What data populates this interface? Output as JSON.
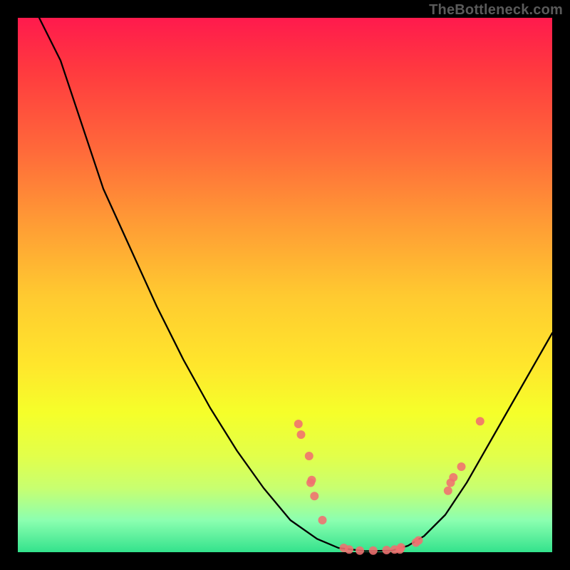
{
  "attribution": "TheBottleneck.com",
  "chart_data": {
    "type": "line",
    "title": "",
    "xlabel": "",
    "ylabel": "",
    "xlim": [
      0,
      100
    ],
    "ylim": [
      0,
      100
    ],
    "series": [
      {
        "name": "curve",
        "type": "line",
        "color": "#000000",
        "x_y": [
          [
            4,
            100
          ],
          [
            8,
            92
          ],
          [
            12,
            80
          ],
          [
            16,
            68
          ],
          [
            21,
            57
          ],
          [
            26,
            46
          ],
          [
            31,
            36
          ],
          [
            36,
            27
          ],
          [
            41,
            19
          ],
          [
            46,
            12
          ],
          [
            51,
            6
          ],
          [
            56,
            2.5
          ],
          [
            60,
            0.8
          ],
          [
            65,
            0.2
          ],
          [
            70,
            0.3
          ],
          [
            73,
            1.2
          ],
          [
            76,
            3
          ],
          [
            80,
            7
          ],
          [
            84,
            13
          ],
          [
            88,
            20
          ],
          [
            92,
            27
          ],
          [
            96,
            34
          ],
          [
            100,
            41
          ]
        ]
      },
      {
        "name": "dots",
        "type": "scatter",
        "color": "#f07070",
        "x_y": [
          [
            52.5,
            24
          ],
          [
            53.0,
            22
          ],
          [
            54.5,
            18
          ],
          [
            55.0,
            13.5
          ],
          [
            54.8,
            13.0
          ],
          [
            55.5,
            10.5
          ],
          [
            57.0,
            6.0
          ],
          [
            61.0,
            0.8
          ],
          [
            62.0,
            0.5
          ],
          [
            64.0,
            0.3
          ],
          [
            66.5,
            0.3
          ],
          [
            69.0,
            0.4
          ],
          [
            70.5,
            0.5
          ],
          [
            71.5,
            0.5
          ],
          [
            71.7,
            0.9
          ],
          [
            74.5,
            1.8
          ],
          [
            75.0,
            2.2
          ],
          [
            80.5,
            11.5
          ],
          [
            81.0,
            13.0
          ],
          [
            81.5,
            14.0
          ],
          [
            83.0,
            16.0
          ],
          [
            86.5,
            24.5
          ]
        ]
      }
    ]
  }
}
